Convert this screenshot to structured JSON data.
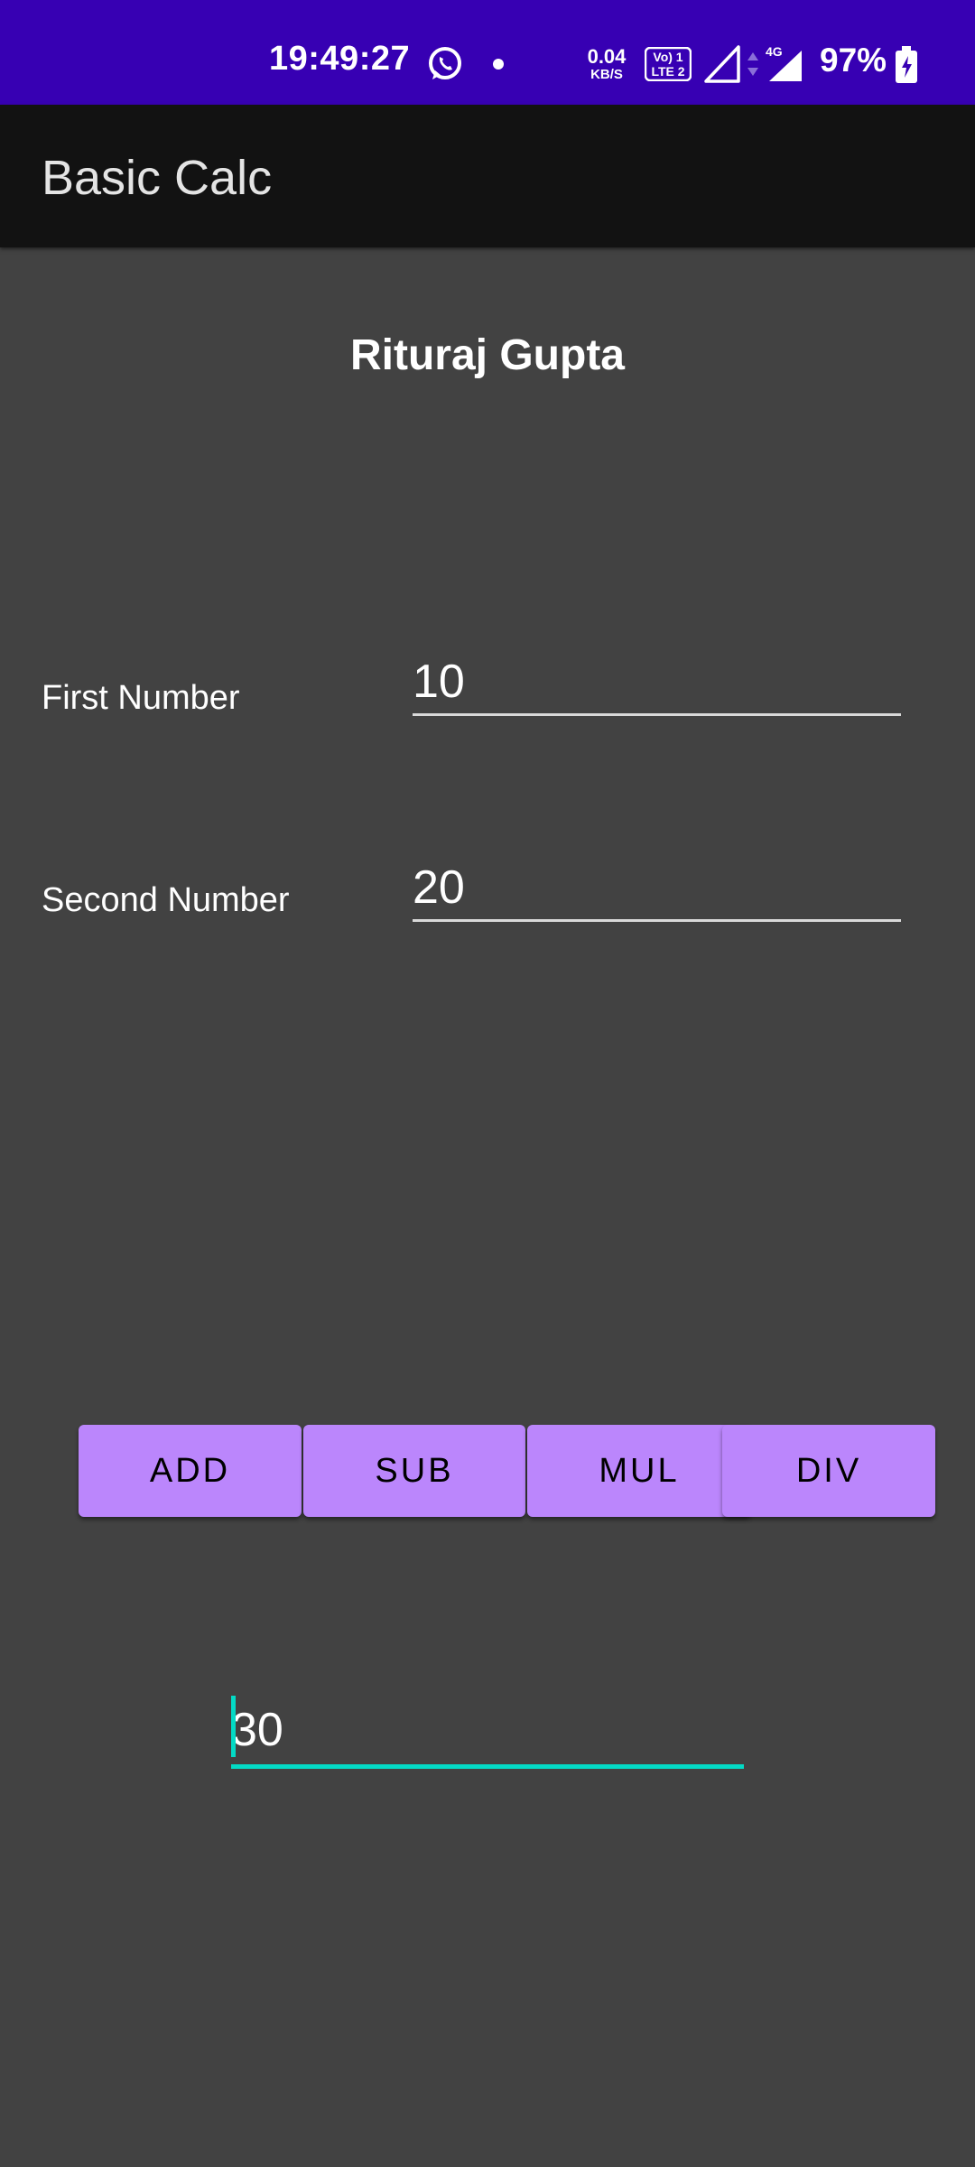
{
  "status_bar": {
    "time": "19:49:27",
    "net_speed_value": "0.04",
    "net_speed_unit": "KB/S",
    "volte_top": "Vo) 1",
    "volte_bottom": "LTE 2",
    "network_type": "4G",
    "battery_percent": "97%",
    "icons": [
      "whatsapp-icon",
      "notification-dot-icon",
      "volte-icon",
      "signal-icon",
      "data-arrows-icon",
      "signal-4g-icon",
      "battery-charging-icon"
    ],
    "background_color": "#3700b3"
  },
  "app_bar": {
    "title": "Basic Calc",
    "background_color": "#121212"
  },
  "content": {
    "author": "Rituraj Gupta",
    "first_label": "First Number",
    "first_value": "10",
    "second_label": "Second Number",
    "second_value": "20",
    "buttons": {
      "add": "ADD",
      "sub": "SUB",
      "mul": "MUL",
      "div": "DIV"
    },
    "result_value": "30",
    "background_color": "#424242",
    "button_color": "#bb86fc",
    "accent_color": "#03dac5"
  }
}
